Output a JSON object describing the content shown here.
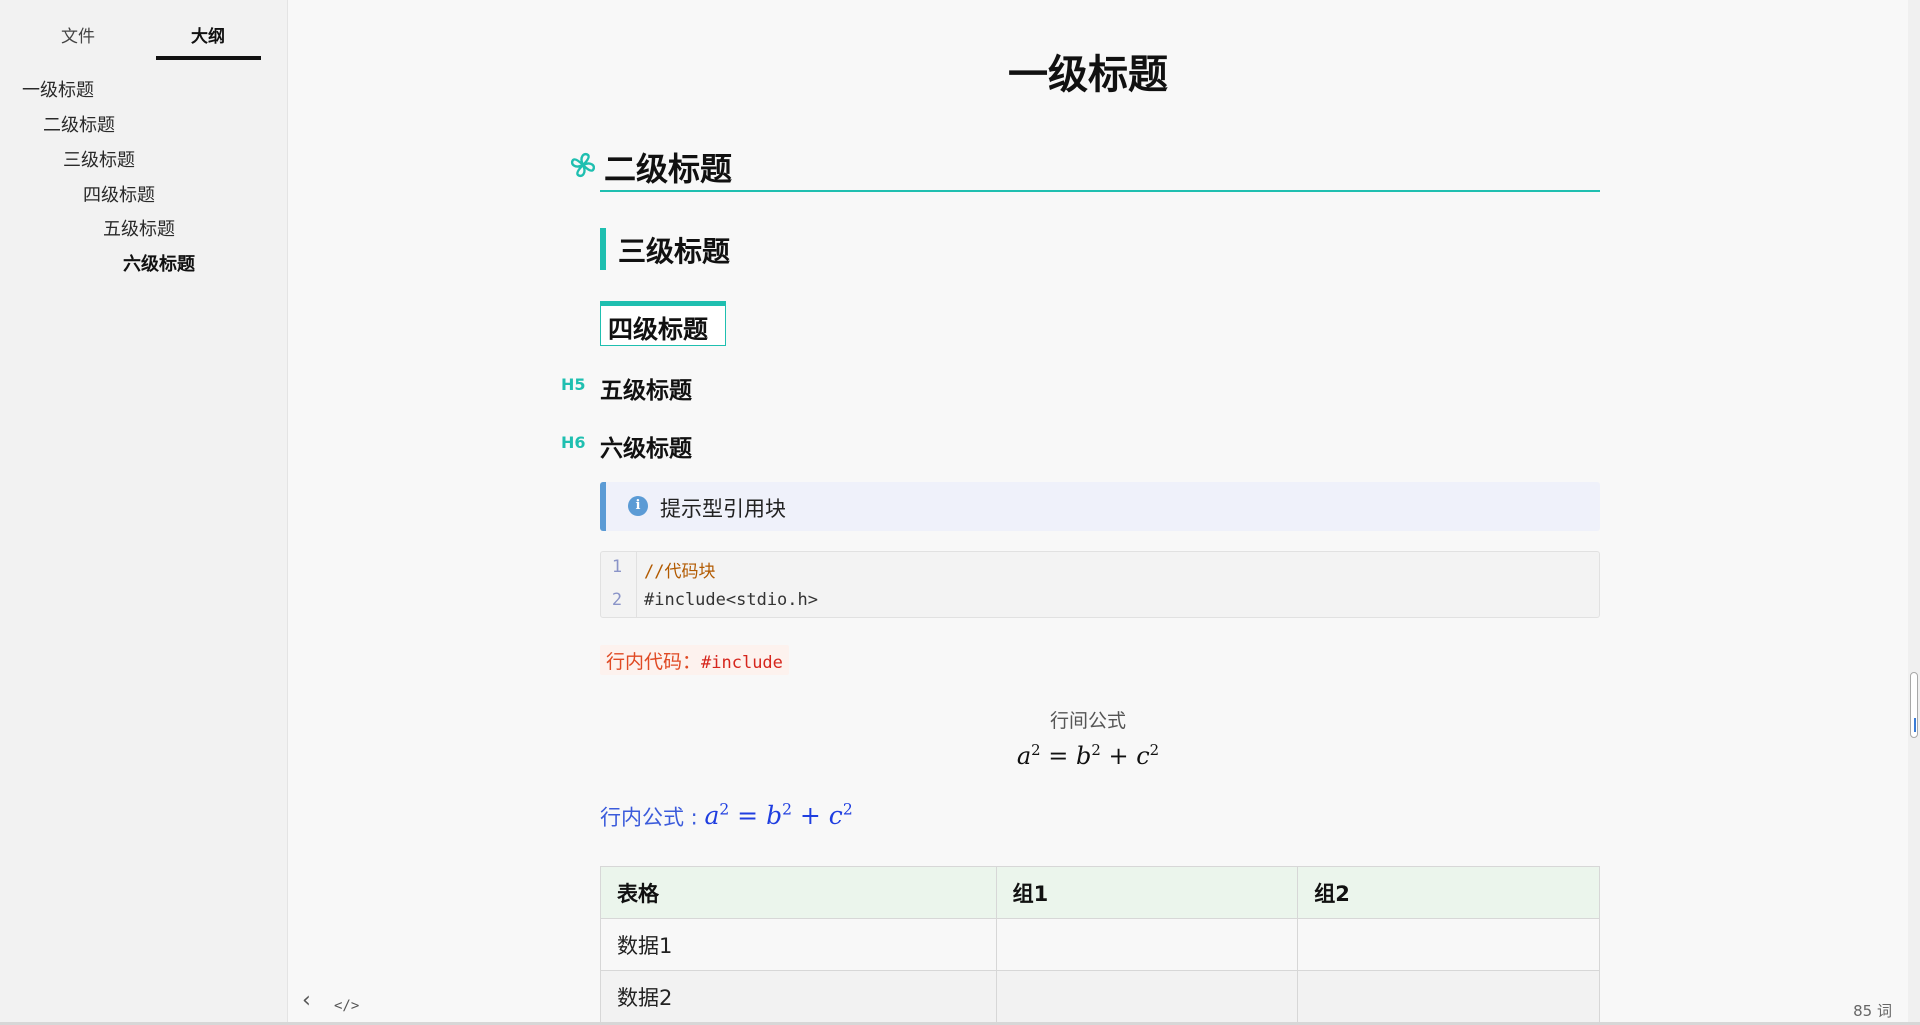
{
  "sidebar": {
    "tabs": [
      {
        "label": "文件"
      },
      {
        "label": "大纲"
      }
    ],
    "outline": [
      {
        "label": "一级标题"
      },
      {
        "label": "二级标题"
      },
      {
        "label": "三级标题"
      },
      {
        "label": "四级标题"
      },
      {
        "label": "五级标题"
      },
      {
        "label": "六级标题"
      }
    ]
  },
  "document": {
    "h1": "一级标题",
    "h2": "二级标题",
    "h3": "三级标题",
    "h4": "四级标题",
    "h5_tag": "H5",
    "h5": "五级标题",
    "h6_tag": "H6",
    "h6": "六级标题",
    "callout": {
      "icon": "info-icon",
      "icon_glyph": "i",
      "text": "提示型引用块"
    },
    "code_block": {
      "lines": [
        {
          "number": "1",
          "text": "//代码块"
        },
        {
          "number": "2",
          "text": "#include<stdio.h>"
        }
      ]
    },
    "inline_code": {
      "label": "行内代码：",
      "code": "#include"
    },
    "display_formula": {
      "caption": "行间公式"
    },
    "inline_formula": {
      "label": "行内公式 : "
    },
    "table": {
      "headers": [
        "表格",
        "组1",
        "组2"
      ],
      "rows": [
        [
          "数据1",
          "",
          ""
        ],
        [
          "数据2",
          "",
          ""
        ]
      ]
    }
  },
  "footer": {
    "back_icon": "chevron-left-icon",
    "source_icon": "code-icon",
    "back_glyph": "‹",
    "source_glyph": "</>",
    "word_count": "85 词"
  },
  "colors": {
    "accent": "#1fbfb0",
    "callout_border": "#5b9bd5",
    "inline_code": "#d6261d",
    "inline_formula": "#3b5bdb"
  }
}
